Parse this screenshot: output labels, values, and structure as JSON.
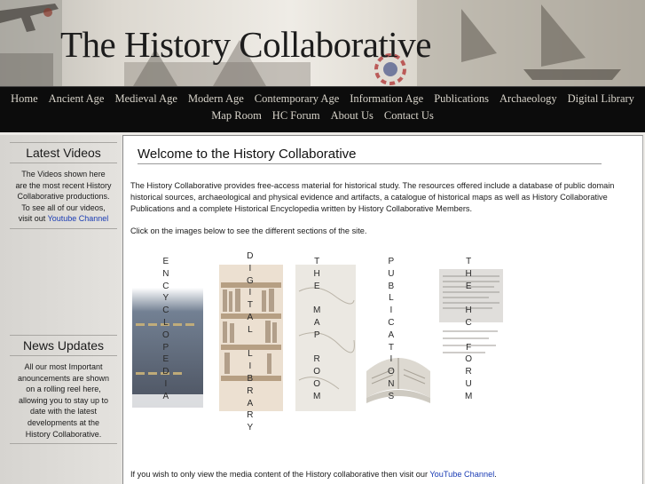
{
  "site": {
    "title": "The History Collaborative"
  },
  "nav": {
    "row1": [
      "Home",
      "Ancient Age",
      "Medieval Age",
      "Modern Age",
      "Contemporary Age",
      "Information Age",
      "Publications",
      "Archaeology",
      "Digital Library"
    ],
    "row2": [
      "Map Room",
      "HC Forum",
      "About Us",
      "Contact Us"
    ]
  },
  "sidebar": {
    "videos": {
      "heading": "Latest Videos",
      "text": "The Videos shown here are the most recent History Collaborative productions. To see all of our videos, visit out",
      "link": "Youtube Channel"
    },
    "news": {
      "heading": "News Updates",
      "text": "All our most Important anouncements are shown on a rolling reel here, allowing you to stay up to date with the latest developments at the History Collaborative."
    }
  },
  "main": {
    "heading": "Welcome to the History Collaborative",
    "intro": "The History Collaborative provides free-access material for historical study. The resources offered include a database of public domain historical sources, archaeological and physical evidence and artifacts, a catalogue of historical maps as well as History Collaborative Publications and a complete Historical Encyclopedia written by History Collaborative Members.",
    "instruction": "Click on the images below to see the different sections of the site.",
    "footer_text": "If you wish to only view the media content of the History collaborative then visit our",
    "footer_link": "YouTube Channel",
    "footer_end": ".",
    "sections": [
      {
        "label": "ENCYCLOPEDIA",
        "icon": "encyclopedia-books-icon"
      },
      {
        "label": "DIGITAL LIBRARY",
        "icon": "library-shelves-icon"
      },
      {
        "label": "THE MAP ROOM",
        "icon": "map-icon"
      },
      {
        "label": "PUBLICATIONS",
        "icon": "open-book-icon"
      },
      {
        "label": "THE HC FORUM",
        "icon": "newspaper-icon"
      }
    ]
  },
  "colors": {
    "nav_bg": "#0c0c0c",
    "link": "#1a3cb4"
  }
}
